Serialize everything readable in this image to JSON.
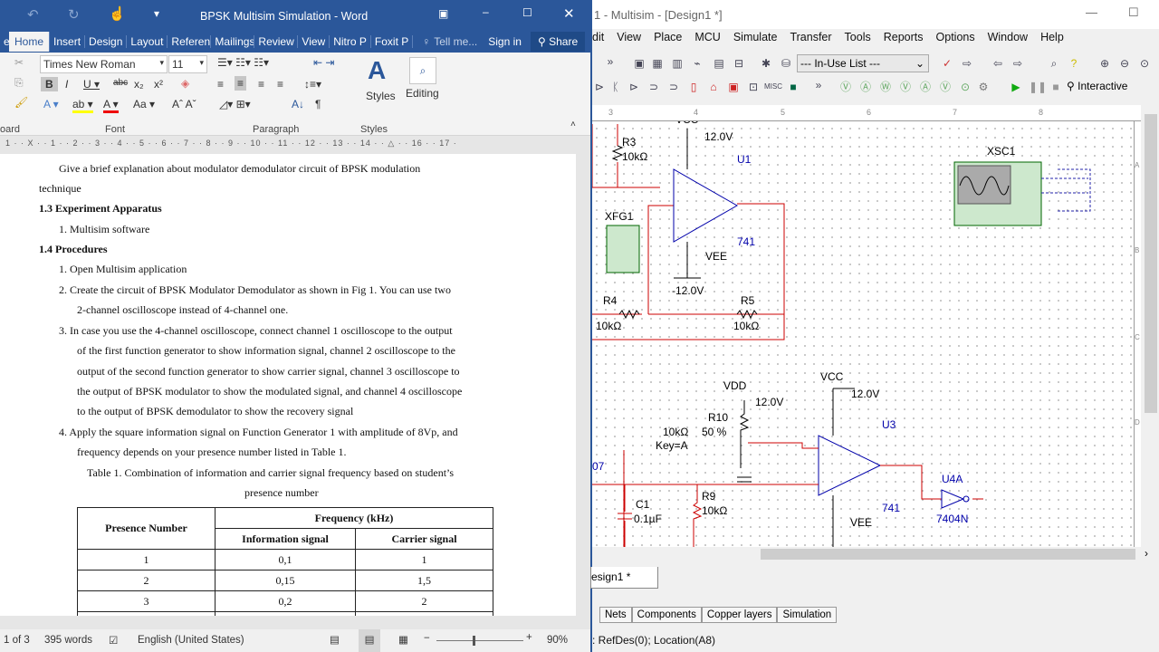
{
  "word": {
    "title": "BPSK Multisim Simulation - Word",
    "tabs": [
      "Home",
      "Insert",
      "Design",
      "Layout",
      "References",
      "Mailings",
      "Review",
      "View",
      "Nitro P",
      "Foxit P"
    ],
    "tell_me": "Tell me...",
    "sign_in": "Sign in",
    "share": "Share",
    "font_name": "Times New Roman",
    "font_size": "11",
    "groups": {
      "clipboard": "oard",
      "font": "Font",
      "paragraph": "Paragraph",
      "styles": "Styles"
    },
    "styles_label": "Styles",
    "editing_label": "Editing",
    "ruler": "1 · · X · · 1 · · 2 · · 3 · · 4 · · 5 · · 6 · · 7 · · 8 · · 9 · · 10 · · 11 · · 12 · · 13 · · 14 · · △ · · 16 · · 17 ·",
    "doc": {
      "p1a": "Give a brief explanation about modulator demodulator circuit of BPSK modulation",
      "p1b": "technique",
      "h13": "1.3  Experiment Apparatus",
      "i1": "1.    Multisim software",
      "h14": "1.4  Procedures",
      "s1": "1.    Open Multisim application",
      "s2a": "2.    Create the circuit of BPSK Modulator Demodulator as shown in Fig 1. You can use two",
      "s2b": "2-channel oscilloscope instead of 4-channel one.",
      "s3a": "3.    In case you use the 4-channel oscilloscope, connect channel 1 oscilloscope to the output",
      "s3b": "of the first function generator to show information signal, channel 2 oscilloscope to the",
      "s3c": "output of the second function generator to show carrier signal, channel 3 oscilloscope to",
      "s3d": "the output of BPSK modulator to show the modulated signal, and channel 4 oscilloscope",
      "s3e": "to the output of BPSK demodulator to show the recovery signal",
      "s4a": "4.    Apply the square information signal on Function Generator 1 with amplitude of 8Vp, and",
      "s4b": "frequency depends on your presence number listed in Table 1.",
      "cap1": "Table 1. Combination of information and carrier signal frequency based on student’s",
      "cap2": "presence number",
      "table": {
        "h_presence": "Presence Number",
        "h_freq": "Frequency (kHz)",
        "h_info": "Information signal",
        "h_carrier": "Carrier signal",
        "rows": [
          [
            "1",
            "0,1",
            "1"
          ],
          [
            "2",
            "0,15",
            "1,5"
          ],
          [
            "3",
            "0,2",
            "2"
          ]
        ]
      }
    },
    "status": {
      "page": "1 of 3",
      "words": "395 words",
      "language": "English (United States)",
      "zoom": "90%"
    }
  },
  "multisim": {
    "title": "1 - Multisim - [Design1 *]",
    "menu": [
      "dit",
      "View",
      "Place",
      "MCU",
      "Simulate",
      "Transfer",
      "Tools",
      "Reports",
      "Options",
      "Window",
      "Help"
    ],
    "in_use_list": "--- In-Use List ---",
    "interactive": "Interactive",
    "misc": "MISC",
    "ruler": [
      "3",
      "4",
      "5",
      "6",
      "7",
      "8"
    ],
    "vruler": [
      "A",
      "B",
      "C",
      "D"
    ],
    "schematic": {
      "vcc1": "VCC",
      "v12a": "12.0V",
      "r3": "R3",
      "r3v": "10kΩ",
      "u1": "U1",
      "xfg1": "XFG1",
      "op741a": "741",
      "vee1": "VEE",
      "vm12": "-12.0V",
      "r4": "R4",
      "r4v": "10kΩ",
      "r5": "R5",
      "r5v": "10kΩ",
      "xsc1": "XSC1",
      "vdd": "VDD",
      "v12b": "12.0V",
      "r10": "R10",
      "r10v": "10kΩ",
      "r10p": "50 %",
      "key": "Key=A",
      "vcc2": "VCC",
      "v12c": "12.0V",
      "u3": "U3",
      "op741b": "741",
      "vee2": "VEE",
      "u4a": "U4A",
      "u4v": "7404N",
      "c1": "C1",
      "c1v": "0.1µF",
      "r9": "R9",
      "r9v": "10kΩ",
      "net07": "07"
    },
    "design_tab": "esign1 *",
    "bottom_tabs": [
      "Nets",
      "Components",
      "Copper layers",
      "Simulation"
    ],
    "status": ": RefDes(0); Location(A8)"
  }
}
